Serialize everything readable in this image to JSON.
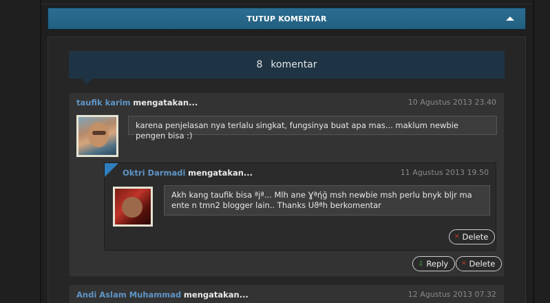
{
  "toggle": {
    "label": "TUTUP KOMENTAR"
  },
  "count": {
    "number": "8",
    "label": "komentar"
  },
  "comments": [
    {
      "author": "taufik karim",
      "says": "mengatakan...",
      "date": "10 Agustus 2013 23.40",
      "text": "karena penjelasan nya terlalu singkat, fungsinya buat apa mas... maklum newbie pengen bisa :)",
      "reply_button": "Reply",
      "delete_button": "Delete",
      "replies": [
        {
          "author": "Oktri Darmadi",
          "says": "mengatakan...",
          "date": "11 Agustus 2013 19.50",
          "text": "Akh kang taufik bisa ªjª... Mlh ane Ɣªήğ msh newbie msh perlu bnyk bljr ma ente n tmn2 blogger lain.. Thanks Uϑªh berkomentar",
          "delete_button": "Delete"
        }
      ]
    },
    {
      "author": "Andi Aslam Muhammad",
      "says": "mengatakan...",
      "date": "12 Agustus 2013 07.32"
    }
  ],
  "icons": {
    "toggle": "caret-up-icon",
    "reply": "arrow-down-icon",
    "delete": "x-icon"
  },
  "colors": {
    "toggle_bar": "#22607f",
    "author_link": "#5e95c6",
    "reply_accent": "#2f7fc0"
  }
}
